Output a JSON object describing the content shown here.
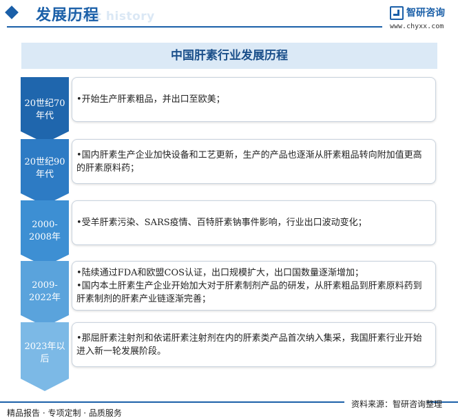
{
  "header": {
    "title": "发展历程",
    "subtitle": "ment history",
    "brand": "智研咨询",
    "url": "www.chyxx.com"
  },
  "banner_title": "中国肝素行业发展历程",
  "timeline": [
    {
      "period": "20世纪70年代",
      "color": "#1f66ad",
      "lines": [
        "•开始生产肝素粗品，并出口至欧美；"
      ]
    },
    {
      "period": "20世纪90年代",
      "color": "#2d7bc4",
      "lines": [
        "•国内肝素生产企业加快设备和工艺更新，生产的产品也逐渐从肝素粗品转向附加值更高的肝素原料药；"
      ]
    },
    {
      "period": "2000-2008年",
      "color": "#3d8fd3",
      "lines": [
        "•受羊肝素污染、SARS疫情、百特肝素钠事件影响，行业出口波动变化；"
      ]
    },
    {
      "period": "2009-2022年",
      "color": "#5aa3dc",
      "lines": [
        "•陆续通过FDA和欧盟COS认证，出口规模扩大，出口国数量逐渐增加；",
        "•国内本土肝素生产企业开始加大对于肝素制剂产品的研发，从肝素粗品到肝素原料药到肝素制剂的肝素产业链逐渐完善；"
      ]
    },
    {
      "period": "2023年以后",
      "color": "#7cb9e6",
      "lines": [
        "•那屈肝素注射剂和依诺肝素注射剂在内的肝素类产品首次纳入集采，我国肝素行业开始进入新一轮发展阶段。"
      ]
    }
  ],
  "footer": {
    "left": "精品报告 · 专项定制 · 品质服务",
    "right": "资料来源：智研咨询整理"
  }
}
